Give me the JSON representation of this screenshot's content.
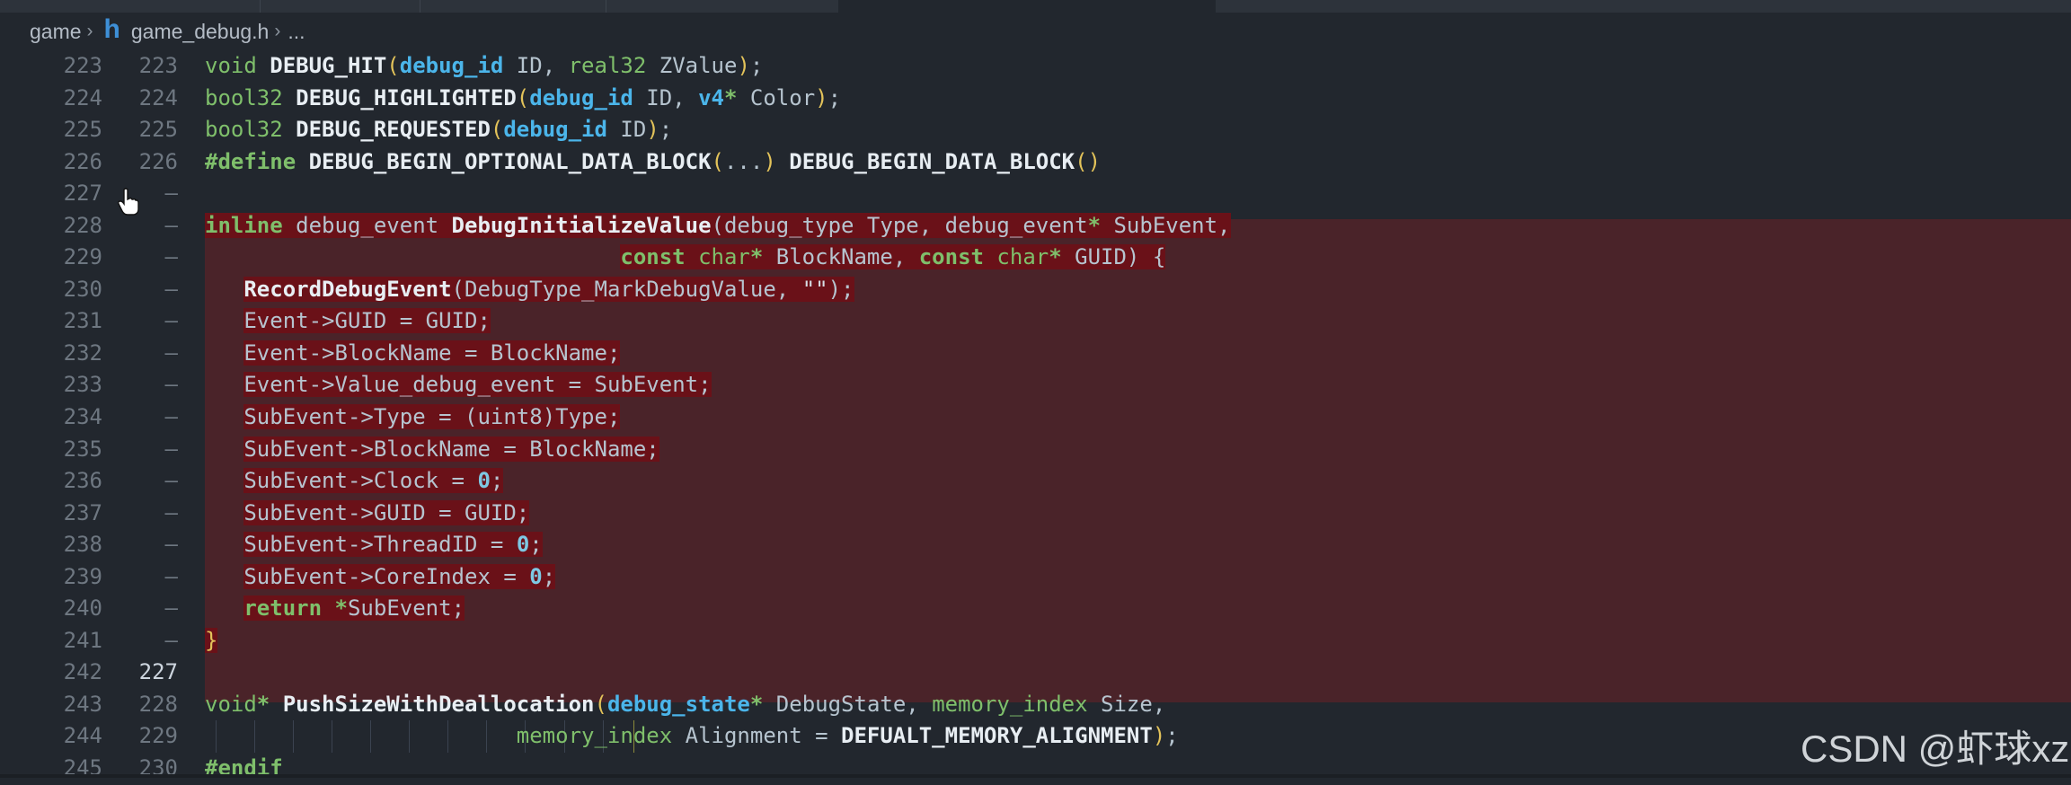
{
  "breadcrumb": {
    "folder": "game",
    "file": "game_debug.h",
    "ellipsis": "...",
    "file_icon": "h"
  },
  "editor": {
    "lines": [
      {
        "old": "223",
        "new": "223",
        "tokens": [
          [
            "kw",
            "void "
          ],
          [
            "fn",
            "DEBUG_HIT"
          ],
          [
            "paren",
            "("
          ],
          [
            "type",
            "debug_id"
          ],
          [
            "id",
            " ID, "
          ],
          [
            "kw",
            "real32"
          ],
          [
            "id",
            " ZValue"
          ],
          [
            "paren",
            ")"
          ],
          [
            "op",
            ";"
          ]
        ]
      },
      {
        "old": "224",
        "new": "224",
        "tokens": [
          [
            "kw",
            "bool32 "
          ],
          [
            "fn",
            "DEBUG_HIGHLIGHTED"
          ],
          [
            "paren",
            "("
          ],
          [
            "type",
            "debug_id"
          ],
          [
            "id",
            " ID, "
          ],
          [
            "type",
            "v4"
          ],
          [
            "kwb",
            "*"
          ],
          [
            "id",
            " Color"
          ],
          [
            "paren",
            ")"
          ],
          [
            "op",
            ";"
          ]
        ]
      },
      {
        "old": "225",
        "new": "225",
        "tokens": [
          [
            "kw",
            "bool32 "
          ],
          [
            "fn",
            "DEBUG_REQUESTED"
          ],
          [
            "paren",
            "("
          ],
          [
            "type",
            "debug_id"
          ],
          [
            "id",
            " ID"
          ],
          [
            "paren",
            ")"
          ],
          [
            "op",
            ";"
          ]
        ]
      },
      {
        "old": "226",
        "new": "226",
        "tokens": [
          [
            "pp",
            "#define "
          ],
          [
            "mac",
            "DEBUG_BEGIN_OPTIONAL_DATA_BLOCK"
          ],
          [
            "paren",
            "("
          ],
          [
            "id",
            "..."
          ],
          [
            "paren",
            ")"
          ],
          [
            "id",
            " "
          ],
          [
            "mac",
            "DEBUG_BEGIN_DATA_BLOCK"
          ],
          [
            "paren",
            "()"
          ]
        ]
      },
      {
        "old": "227",
        "new": "—",
        "tokens": []
      },
      {
        "old": "228",
        "new": "—",
        "hl": true,
        "tokens": [
          [
            "kwb",
            "inline"
          ],
          [
            "id",
            " debug_event "
          ],
          [
            "fn",
            "DebugInitializeValue"
          ],
          [
            "id",
            "(debug_type Type, debug_event"
          ],
          [
            "kwb",
            "*"
          ],
          [
            "id",
            " SubEvent,"
          ]
        ]
      },
      {
        "old": "229",
        "new": "—",
        "hl": true,
        "tokens": [
          [
            "id",
            "                                "
          ],
          [
            "kwb",
            "const"
          ],
          [
            "kw",
            " char"
          ],
          [
            "kwb",
            "*"
          ],
          [
            "id",
            " BlockName, "
          ],
          [
            "kwb",
            "const"
          ],
          [
            "kw",
            " char"
          ],
          [
            "kwb",
            "*"
          ],
          [
            "id",
            " GUID) {"
          ]
        ]
      },
      {
        "old": "230",
        "new": "—",
        "hl": true,
        "tokens": [
          [
            "id",
            "   "
          ],
          [
            "fn",
            "RecordDebugEvent"
          ],
          [
            "id",
            "(DebugType_MarkDebugValue, "
          ],
          [
            "str",
            "\"\""
          ],
          [
            "id",
            ");"
          ]
        ]
      },
      {
        "old": "231",
        "new": "—",
        "hl": true,
        "tokens": [
          [
            "id",
            "   Event->GUID "
          ],
          [
            "op",
            "="
          ],
          [
            "id",
            " GUID;"
          ]
        ]
      },
      {
        "old": "232",
        "new": "—",
        "hl": true,
        "tokens": [
          [
            "id",
            "   Event->BlockName "
          ],
          [
            "op",
            "="
          ],
          [
            "id",
            " BlockName;"
          ]
        ]
      },
      {
        "old": "233",
        "new": "—",
        "hl": true,
        "tokens": [
          [
            "id",
            "   Event->Value_debug_event "
          ],
          [
            "op",
            "="
          ],
          [
            "id",
            " SubEvent;"
          ]
        ]
      },
      {
        "old": "234",
        "new": "—",
        "hl": true,
        "tokens": [
          [
            "id",
            "   SubEvent->Type "
          ],
          [
            "op",
            "="
          ],
          [
            "id",
            " (uint8)Type;"
          ]
        ]
      },
      {
        "old": "235",
        "new": "—",
        "hl": true,
        "tokens": [
          [
            "id",
            "   SubEvent->BlockName "
          ],
          [
            "op",
            "="
          ],
          [
            "id",
            " BlockName;"
          ]
        ]
      },
      {
        "old": "236",
        "new": "—",
        "hl": true,
        "tokens": [
          [
            "id",
            "   SubEvent->Clock "
          ],
          [
            "op",
            "="
          ],
          [
            "id",
            " "
          ],
          [
            "num",
            "0"
          ],
          [
            "id",
            ";"
          ]
        ]
      },
      {
        "old": "237",
        "new": "—",
        "hl": true,
        "tokens": [
          [
            "id",
            "   SubEvent->GUID "
          ],
          [
            "op",
            "="
          ],
          [
            "id",
            " GUID;"
          ]
        ]
      },
      {
        "old": "238",
        "new": "—",
        "hl": true,
        "tokens": [
          [
            "id",
            "   SubEvent->ThreadID "
          ],
          [
            "op",
            "="
          ],
          [
            "id",
            " "
          ],
          [
            "num",
            "0"
          ],
          [
            "id",
            ";"
          ]
        ]
      },
      {
        "old": "239",
        "new": "—",
        "hl": true,
        "tokens": [
          [
            "id",
            "   SubEvent->CoreIndex "
          ],
          [
            "op",
            "="
          ],
          [
            "id",
            " "
          ],
          [
            "num",
            "0"
          ],
          [
            "id",
            ";"
          ]
        ]
      },
      {
        "old": "240",
        "new": "—",
        "hl": true,
        "tokens": [
          [
            "id",
            "   "
          ],
          [
            "kwb",
            "return"
          ],
          [
            "id",
            " "
          ],
          [
            "kwb",
            "*"
          ],
          [
            "id",
            "SubEvent;"
          ]
        ]
      },
      {
        "old": "241",
        "new": "—",
        "hl": true,
        "tokens": [
          [
            "paren",
            "}"
          ]
        ]
      },
      {
        "old": "242",
        "new": "227",
        "cur": true,
        "tokens": []
      },
      {
        "old": "243",
        "new": "228",
        "tokens": [
          [
            "kw",
            "void"
          ],
          [
            "kwb",
            "*"
          ],
          [
            "id",
            " "
          ],
          [
            "fn",
            "PushSizeWithDeallocation"
          ],
          [
            "paren",
            "("
          ],
          [
            "type",
            "debug_state"
          ],
          [
            "kwb",
            "*"
          ],
          [
            "id",
            " DebugState, "
          ],
          [
            "kw",
            "memory_index"
          ],
          [
            "id",
            " Size,"
          ]
        ]
      },
      {
        "old": "244",
        "new": "229",
        "tokens": [
          [
            "id",
            "                        "
          ],
          [
            "kw",
            "memory_index"
          ],
          [
            "id",
            " Alignment "
          ],
          [
            "op",
            "="
          ],
          [
            "id",
            " "
          ],
          [
            "fn",
            "DEFUALT_MEMORY_ALIGNMENT"
          ],
          [
            "paren",
            ")"
          ],
          [
            "op",
            ";"
          ]
        ]
      },
      {
        "old": "245",
        "new": "230",
        "tokens": [
          [
            "pp",
            "#endif"
          ]
        ]
      }
    ]
  },
  "watermark": "CSDN @虾球xz",
  "colors": {
    "background": "#22272e",
    "removed_block": "#4a2329",
    "removed_text_highlight": "#6a1118",
    "keyword": "#7fbf6b",
    "type": "#4bb5ea"
  },
  "icons": {
    "cursor": "hand-pointer-icon",
    "chevron": "chevron-right-icon"
  }
}
